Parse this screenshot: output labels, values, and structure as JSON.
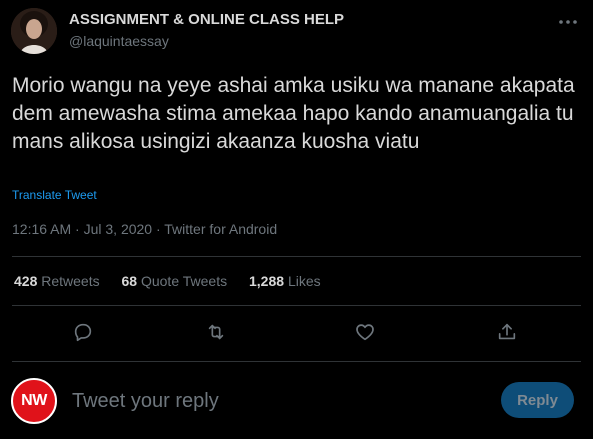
{
  "author": {
    "name": "ASSIGNMENT & ONLINE CLASS HELP",
    "handle": "@laquintaessay",
    "avatar_icon": "profile-photo"
  },
  "tweet": {
    "text": "Morio wangu na yeye ashai amka usiku wa manane akapata dem amewasha stima amekaa hapo kando anamuangalia tu mans alikosa usingizi akaanza kuosha viatu",
    "translate_label": "Translate Tweet",
    "timestamp": "12:16 AM · Jul 3, 2020 · Twitter for Android"
  },
  "stats": {
    "retweets": {
      "count": "428",
      "label": "Retweets"
    },
    "quote_tweets": {
      "count": "68",
      "label": "Quote Tweets"
    },
    "likes": {
      "count": "1,288",
      "label": "Likes"
    }
  },
  "actions": [
    "reply-icon",
    "retweet-icon",
    "like-icon",
    "share-icon"
  ],
  "reply_box": {
    "avatar_text": "NW",
    "placeholder": "Tweet your reply",
    "button_label": "Reply"
  },
  "colors": {
    "background": "#000000",
    "text": "#d9d9d9",
    "secondary": "#6e767d",
    "link": "#1d9bf0",
    "reply_button": "#0e4d78",
    "nw_badge": "#e0121a"
  }
}
